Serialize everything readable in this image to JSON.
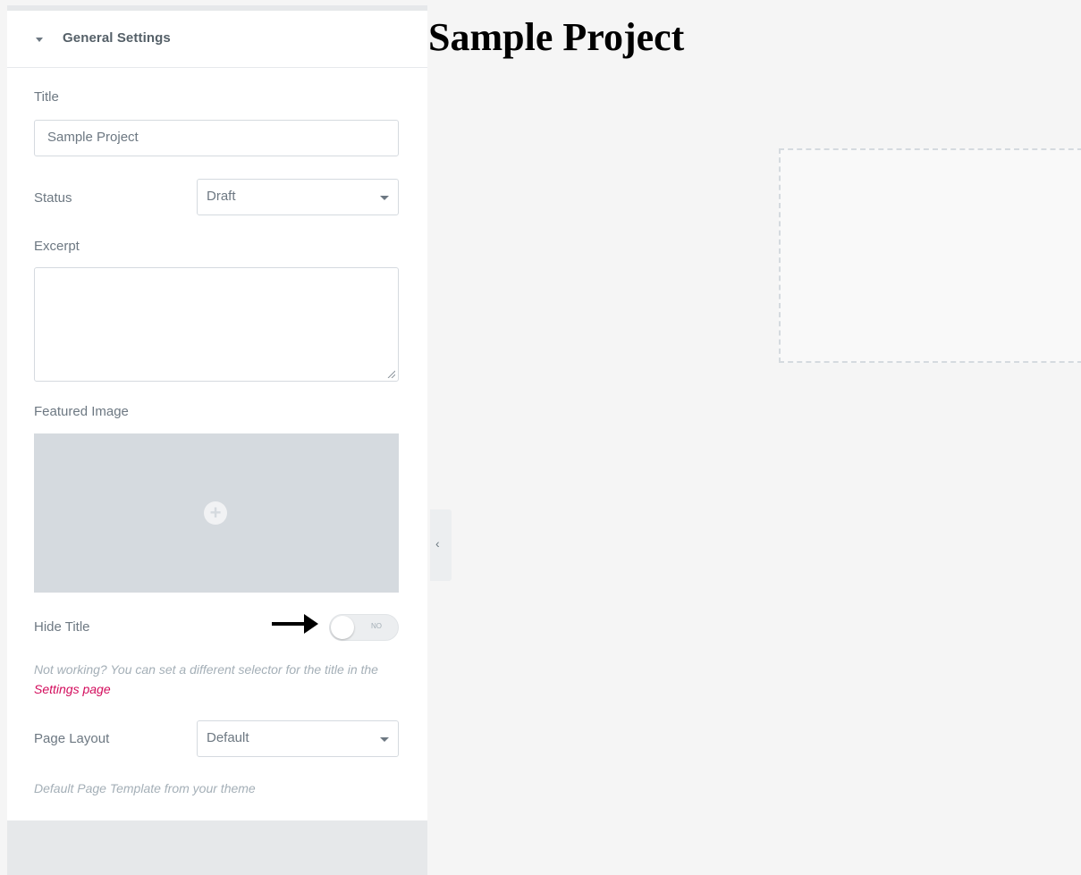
{
  "panel": {
    "section_title": "General Settings",
    "title_label": "Title",
    "title_value": "Sample Project",
    "status_label": "Status",
    "status_value": "Draft",
    "excerpt_label": "Excerpt",
    "featured_image_label": "Featured Image",
    "hide_title_label": "Hide Title",
    "hide_title_toggle_text": "NO",
    "hide_title_help": "Not working? You can set a different selector for the title in the ",
    "hide_title_help_link": "Settings page",
    "page_layout_label": "Page Layout",
    "page_layout_value": "Default",
    "page_layout_help": "Default Page Template from your theme"
  },
  "preview": {
    "page_title": "Sample Project"
  },
  "colors": {
    "accent_link": "#d30c5c",
    "label": "#6d7882",
    "border": "#d5dadf"
  },
  "icons": [
    "caret-down-icon",
    "select-caret-icon",
    "plus-icon",
    "arrow-right-icon",
    "chevron-left-icon"
  ]
}
